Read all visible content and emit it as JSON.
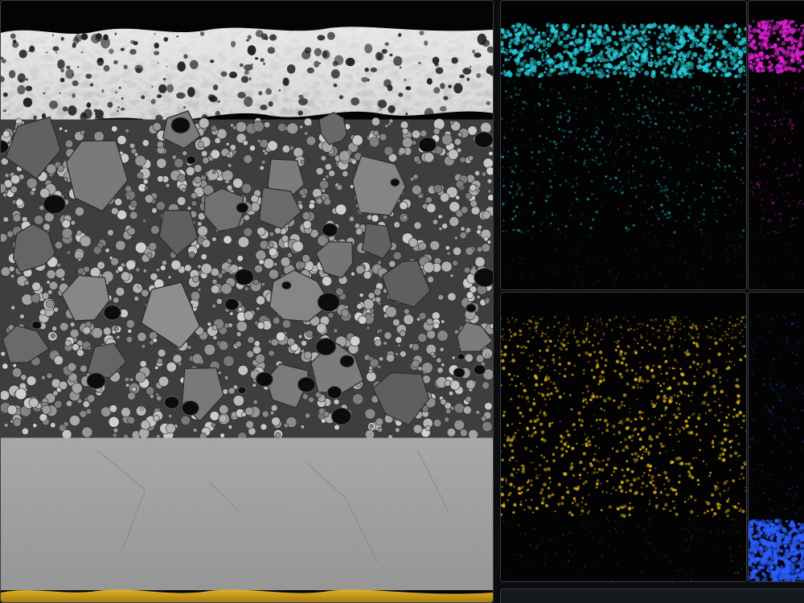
{
  "app": {
    "panels": [
      {
        "id": "sem-viewport",
        "kind": "sem-image"
      },
      {
        "id": "map-1",
        "kind": "element-map",
        "color": "#26d3e0"
      },
      {
        "id": "map-2",
        "kind": "element-map",
        "color": "#e020d6"
      },
      {
        "id": "map-3",
        "kind": "element-map",
        "color": "#f2c21a"
      },
      {
        "id": "map-4",
        "kind": "element-map",
        "color": "#2a5cff"
      }
    ],
    "colors": {
      "background": "#0b0d10",
      "panel_border": "#3a3f46",
      "coating_top": "#d8d8d8",
      "particle_layer": "#5a5a5a",
      "substrate": "#9a9a9a",
      "gold_layer": "#d4a21a"
    }
  }
}
